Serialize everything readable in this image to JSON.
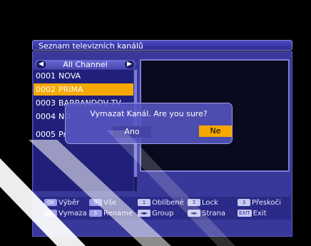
{
  "title": "Seznam televizních kanálů",
  "channel_group": "All Channel",
  "channels": [
    {
      "number": "0001",
      "name": "NOVA"
    },
    {
      "number": "0002",
      "name": "PRIMA"
    },
    {
      "number": "0003",
      "name": "BARRANDOV TV"
    },
    {
      "number": "0004",
      "name": "NO"
    },
    {
      "number": "0005",
      "name": "Pr"
    }
  ],
  "selected_index": 1,
  "dialog": {
    "message": "Vymazat Kanál. Are you sure?",
    "yes_label": "Ano",
    "no_label": "Ne"
  },
  "footer": {
    "row1": [
      {
        "key": "OK",
        "label": "Výběr"
      },
      {
        "key": "0",
        "label": "Vše"
      },
      {
        "key": "1",
        "label": "Oblíbené"
      },
      {
        "key": "2",
        "label": "Lock"
      },
      {
        "key": "3",
        "label": "Přeskoči"
      }
    ],
    "row2": [
      {
        "key": "4",
        "label": "Vymaza"
      },
      {
        "key": "5",
        "label": "Rename"
      },
      {
        "key": "◄►",
        "label": "Group"
      },
      {
        "key": "◄►",
        "label": "Strana"
      },
      {
        "key": "EXIT",
        "label": "Exit"
      }
    ]
  },
  "colors": {
    "panel": "#38389a",
    "highlight": "#f6a800",
    "title_bar": "#3a3ab0"
  }
}
